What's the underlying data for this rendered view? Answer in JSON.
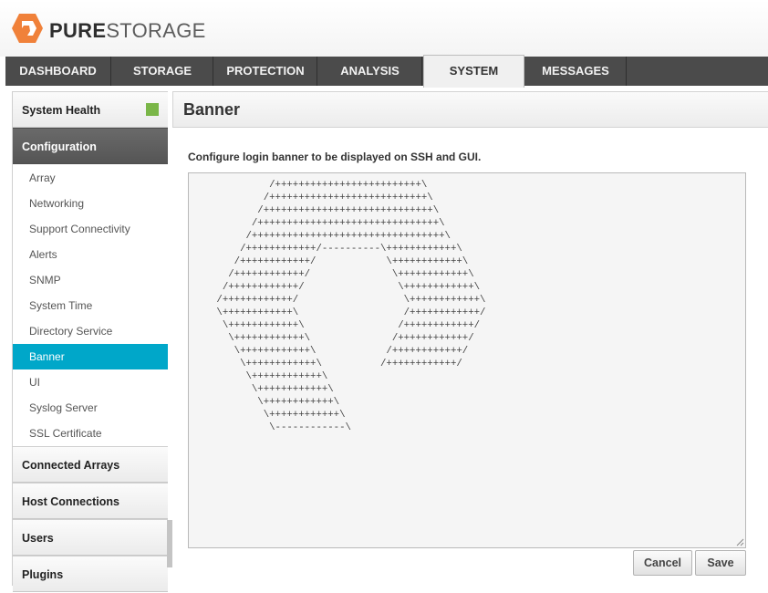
{
  "brand": {
    "part1": "PURE",
    "part2": "STORAGE",
    "logo_icon": "pure-storage-logo-icon",
    "logo_color": "#f0813a"
  },
  "nav": {
    "tabs": [
      {
        "label": "DASHBOARD"
      },
      {
        "label": "STORAGE"
      },
      {
        "label": "PROTECTION"
      },
      {
        "label": "ANALYSIS"
      },
      {
        "label": "SYSTEM"
      },
      {
        "label": "MESSAGES"
      }
    ],
    "active": "SYSTEM"
  },
  "sidebar": {
    "system_health": {
      "label": "System Health",
      "status_color": "#7ab648"
    },
    "configuration": {
      "label": "Configuration"
    },
    "items": [
      {
        "label": "Array"
      },
      {
        "label": "Networking"
      },
      {
        "label": "Support Connectivity"
      },
      {
        "label": "Alerts"
      },
      {
        "label": "SNMP"
      },
      {
        "label": "System Time"
      },
      {
        "label": "Directory Service"
      },
      {
        "label": "Banner"
      },
      {
        "label": "UI"
      },
      {
        "label": "Syslog Server"
      },
      {
        "label": "SSL Certificate"
      }
    ],
    "active_item": "Banner",
    "sections": [
      {
        "label": "Connected Arrays"
      },
      {
        "label": "Host Connections"
      },
      {
        "label": "Users"
      },
      {
        "label": "Plugins"
      }
    ],
    "accent_color": "#00a7c9"
  },
  "main": {
    "title": "Banner",
    "instruction": "Configure login banner to be displayed on SSH and GUI.",
    "banner_text": "          /+++++++++++++++++++++++++\\\n         /+++++++++++++++++++++++++++\\\n        /+++++++++++++++++++++++++++++\\\n       /+++++++++++++++++++++++++++++++\\\n      /+++++++++++++++++++++++++++++++++\\\n     /++++++++++++/----------\\++++++++++++\\\n    /++++++++++++/            \\++++++++++++\\\n   /++++++++++++/              \\++++++++++++\\\n  /++++++++++++/                \\++++++++++++\\\n /++++++++++++/                  \\++++++++++++\\\n \\++++++++++++\\                  /++++++++++++/\n  \\++++++++++++\\                /++++++++++++/\n   \\++++++++++++\\              /++++++++++++/\n    \\++++++++++++\\            /++++++++++++/\n     \\++++++++++++\\          /++++++++++++/\n      \\++++++++++++\\\n       \\++++++++++++\\\n        \\++++++++++++\\\n         \\++++++++++++\\\n          \\------------\\",
    "cancel_label": "Cancel",
    "save_label": "Save"
  }
}
